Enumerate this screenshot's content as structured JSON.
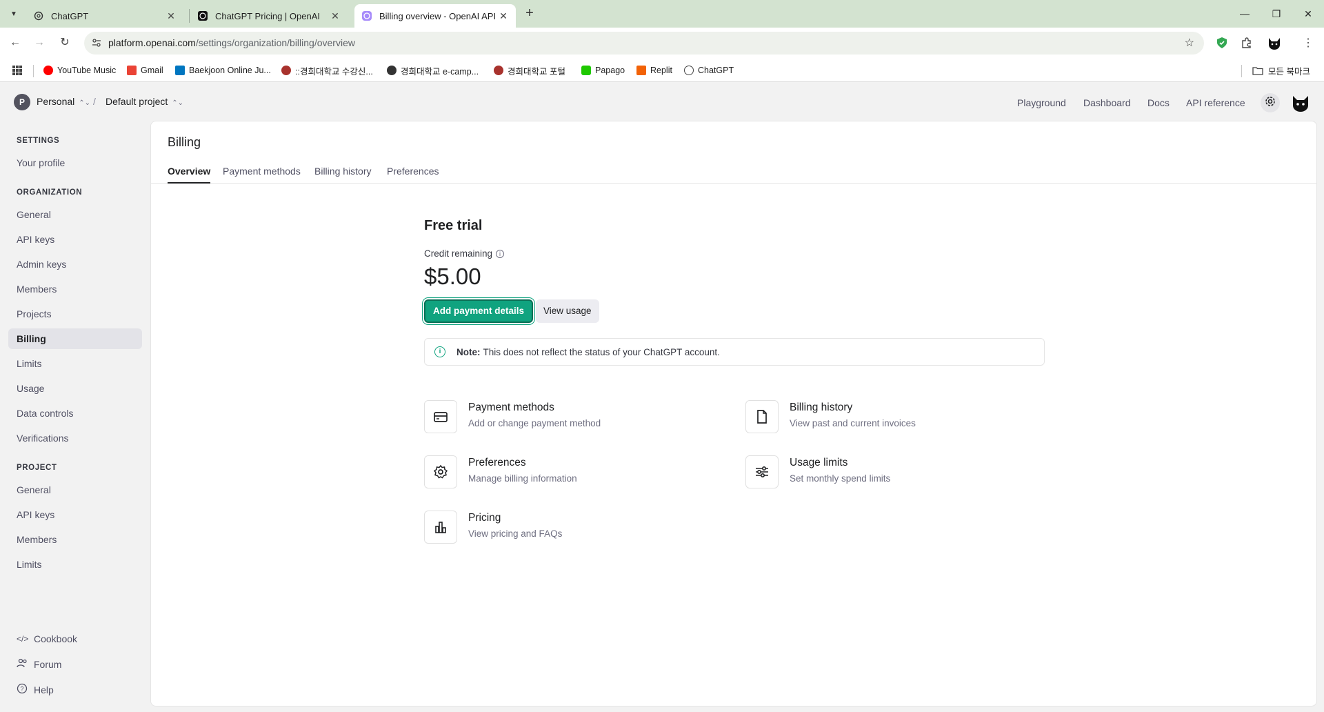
{
  "browser": {
    "tabs": [
      {
        "title": "ChatGPT",
        "active": false
      },
      {
        "title": "ChatGPT Pricing | OpenAI",
        "active": false
      },
      {
        "title": "Billing overview - OpenAI API",
        "active": true
      }
    ],
    "url_host": "platform.openai.com",
    "url_path": "/settings/organization/billing/overview",
    "bookmarks": [
      {
        "label": "YouTube Music",
        "color": "#ff0000"
      },
      {
        "label": "Gmail",
        "color": "#ea4335"
      },
      {
        "label": "Baekjoon Online Ju...",
        "color": "#0076c0"
      },
      {
        "label": "::경희대학교 수강신...",
        "color": "#a8322d"
      },
      {
        "label": "경희대학교 e-camp...",
        "color": "#333333"
      },
      {
        "label": "경희대학교 포털",
        "color": "#a8322d"
      },
      {
        "label": "Papago",
        "color": "#1ec800"
      },
      {
        "label": "Replit",
        "color": "#f26207"
      },
      {
        "label": "ChatGPT",
        "color": "#444444"
      }
    ],
    "all_bookmarks": "모든 북마크"
  },
  "header": {
    "org_initial": "P",
    "org_name": "Personal",
    "project_name": "Default project",
    "links": [
      "Playground",
      "Dashboard",
      "Docs",
      "API reference"
    ]
  },
  "sidebar": {
    "settings_heading": "SETTINGS",
    "your_profile": "Your profile",
    "organization_heading": "ORGANIZATION",
    "org_items": [
      "General",
      "API keys",
      "Admin keys",
      "Members",
      "Projects",
      "Billing",
      "Limits",
      "Usage",
      "Data controls",
      "Verifications"
    ],
    "project_heading": "PROJECT",
    "project_items": [
      "General",
      "API keys",
      "Members",
      "Limits"
    ],
    "footer": [
      "Cookbook",
      "Forum",
      "Help"
    ]
  },
  "billing": {
    "title": "Billing",
    "tabs": [
      "Overview",
      "Payment methods",
      "Billing history",
      "Preferences"
    ],
    "plan": "Free trial",
    "credit_label": "Credit remaining",
    "credit_amount": "$5.00",
    "add_payment_label": "Add payment details",
    "view_usage_label": "View usage",
    "note_bold": "Note:",
    "note_text": "This does not reflect the status of your ChatGPT account.",
    "cards": [
      {
        "title": "Payment methods",
        "subtitle": "Add or change payment method",
        "icon": "credit-card-icon"
      },
      {
        "title": "Billing history",
        "subtitle": "View past and current invoices",
        "icon": "document-icon"
      },
      {
        "title": "Preferences",
        "subtitle": "Manage billing information",
        "icon": "gear-icon"
      },
      {
        "title": "Usage limits",
        "subtitle": "Set monthly spend limits",
        "icon": "sliders-icon"
      },
      {
        "title": "Pricing",
        "subtitle": "View pricing and FAQs",
        "icon": "bar-chart-icon"
      }
    ]
  },
  "colors": {
    "accent": "#10a37f",
    "tabbar": "#d3e3d0"
  }
}
